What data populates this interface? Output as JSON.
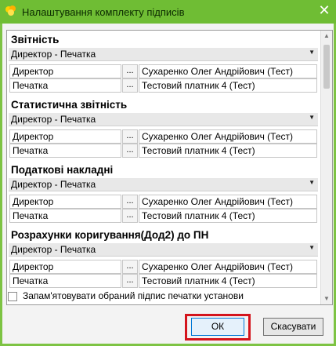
{
  "window": {
    "title": "Налаштування комплекту підписів",
    "close": "✕"
  },
  "sections": [
    {
      "title": "Звітність",
      "combo": "Директор - Печатка",
      "rows": [
        {
          "role": "Директор",
          "btn": "...",
          "value": "Сухаренко Олег Андрійович (Тест)"
        },
        {
          "role": "Печатка",
          "btn": "...",
          "value": "Тестовий платник 4 (Тест)"
        }
      ]
    },
    {
      "title": "Статистична звітність",
      "combo": "Директор - Печатка",
      "rows": [
        {
          "role": "Директор",
          "btn": "...",
          "value": "Сухаренко Олег Андрійович (Тест)"
        },
        {
          "role": "Печатка",
          "btn": "...",
          "value": "Тестовий платник 4 (Тест)"
        }
      ]
    },
    {
      "title": "Податкові накладні",
      "combo": "Директор - Печатка",
      "rows": [
        {
          "role": "Директор",
          "btn": "...",
          "value": "Сухаренко Олег Андрійович (Тест)"
        },
        {
          "role": "Печатка",
          "btn": "...",
          "value": "Тестовий платник 4 (Тест)"
        }
      ]
    },
    {
      "title": "Розрахунки коригування(Дод2) до ПН",
      "combo": "Директор - Печатка",
      "rows": [
        {
          "role": "Директор",
          "btn": "...",
          "value": "Сухаренко Олег Андрійович (Тест)"
        },
        {
          "role": "Печатка",
          "btn": "...",
          "value": "Тестовий платник 4 (Тест)"
        }
      ]
    }
  ],
  "remember_checkbox": {
    "label": "Запам'ятовувати обраний підпис печатки установи",
    "checked": false
  },
  "buttons": {
    "ok": "ОК",
    "cancel": "Скасувати"
  },
  "colors": {
    "title_bar": "#6fbd34",
    "highlight": "#d4141c"
  },
  "icons": {
    "app_icon": "app-logo-icon",
    "dropdown": "chevron-down-icon"
  }
}
